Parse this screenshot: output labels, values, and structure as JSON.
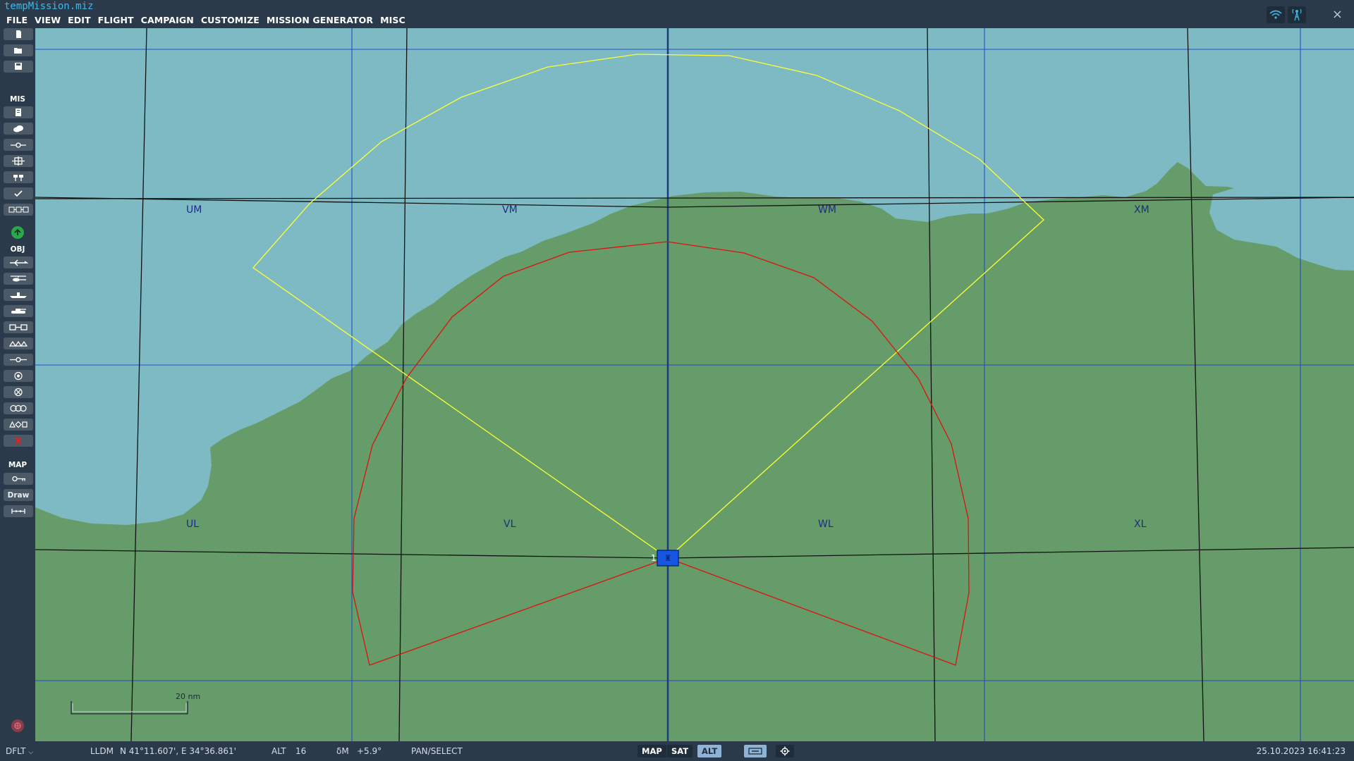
{
  "window": {
    "title": "tempMission.miz",
    "close_glyph": "×",
    "icons": [
      "wifi-icon",
      "antenna-icon"
    ]
  },
  "menu": {
    "items": [
      "FILE",
      "VIEW",
      "EDIT",
      "FLIGHT",
      "CAMPAIGN",
      "CUSTOMIZE",
      "MISSION GENERATOR",
      "MISC"
    ]
  },
  "toolbar": {
    "section_mis": "MIS",
    "section_obj": "OBJ",
    "section_map": "MAP",
    "draw_label": "Draw"
  },
  "map": {
    "grid_labels": [
      "UM",
      "VM",
      "WM",
      "XM",
      "UL",
      "VL",
      "WL",
      "XL"
    ],
    "scale_label": "20 nm",
    "unit_label": "1",
    "colors": {
      "sea": "#7ebac4",
      "land": "#669c69",
      "yellow_zone": "#ffff33",
      "red_zone": "#e01010",
      "unit": "#1756e0"
    }
  },
  "status": {
    "profile": "DFLT",
    "coord_mode": "LLDM",
    "coords": "N 41°11.607', E 34°36.861'",
    "alt_label": "ALT",
    "alt_value": "16",
    "mag_label": "δM",
    "mag_value": "+5.9°",
    "mode": "PAN/SELECT",
    "btn_map": "MAP",
    "btn_sat": "SAT",
    "btn_alt": "ALT",
    "datetime": "25.10.2023 16:41:23"
  }
}
